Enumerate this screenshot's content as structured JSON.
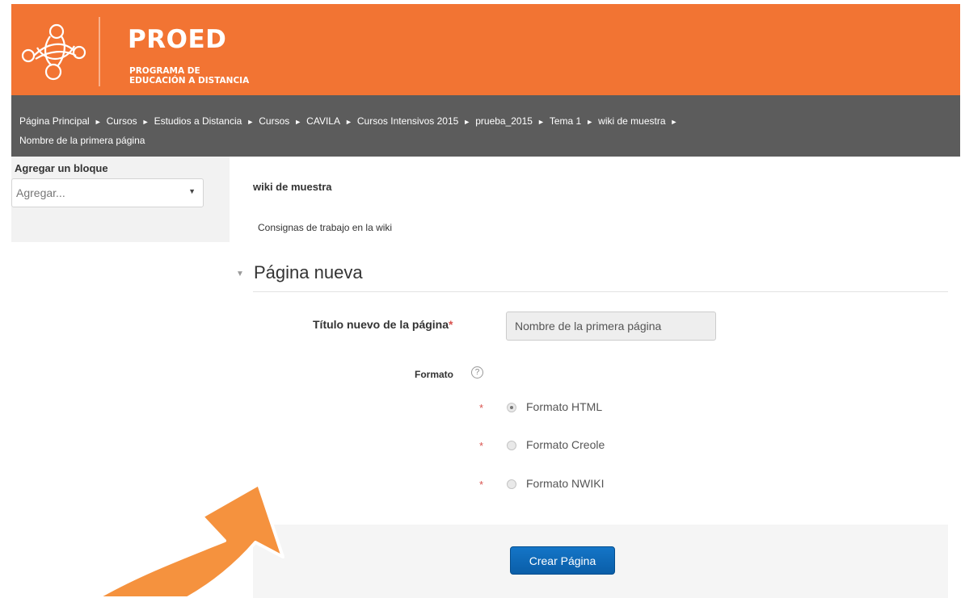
{
  "header": {
    "brand": "PROED",
    "subtitle_line1": "PROGRAMA DE",
    "subtitle_line2": "EDUCACIÓN A DISTANCIA",
    "logo_icon": "proed-logo-icon",
    "background_color": "#f27433"
  },
  "breadcrumb": {
    "items": [
      "Página Principal",
      "Cursos",
      "Estudios a Distancia",
      "Cursos",
      "CAVILA",
      "Cursos Intensivos 2015",
      "prueba_2015",
      "Tema 1",
      "wiki de muestra",
      "Nombre de la primera página"
    ],
    "separator": "►",
    "background_color": "#5c5c5c"
  },
  "sidebar": {
    "block_title": "Agregar un bloque",
    "select_value": "Agregar..."
  },
  "main": {
    "wiki_name": "wiki de muestra",
    "wiki_description": "Consignas de trabajo en la wiki",
    "section_legend": "Página nueva",
    "title_label": "Título nuevo de la página",
    "required_mark": "*",
    "title_value": "Nombre de la primera página",
    "format_label": "Formato",
    "help_icon": "question-circle-icon",
    "formats": [
      {
        "label": "Formato HTML",
        "checked": true
      },
      {
        "label": "Formato Creole",
        "checked": false
      },
      {
        "label": "Formato NWIKI",
        "checked": false
      }
    ],
    "submit_label": "Crear Página",
    "submit_color": "#0a66b5"
  },
  "annotation": {
    "arrow_icon": "orange-arrow-annotation",
    "arrow_color": "#f5923e"
  }
}
